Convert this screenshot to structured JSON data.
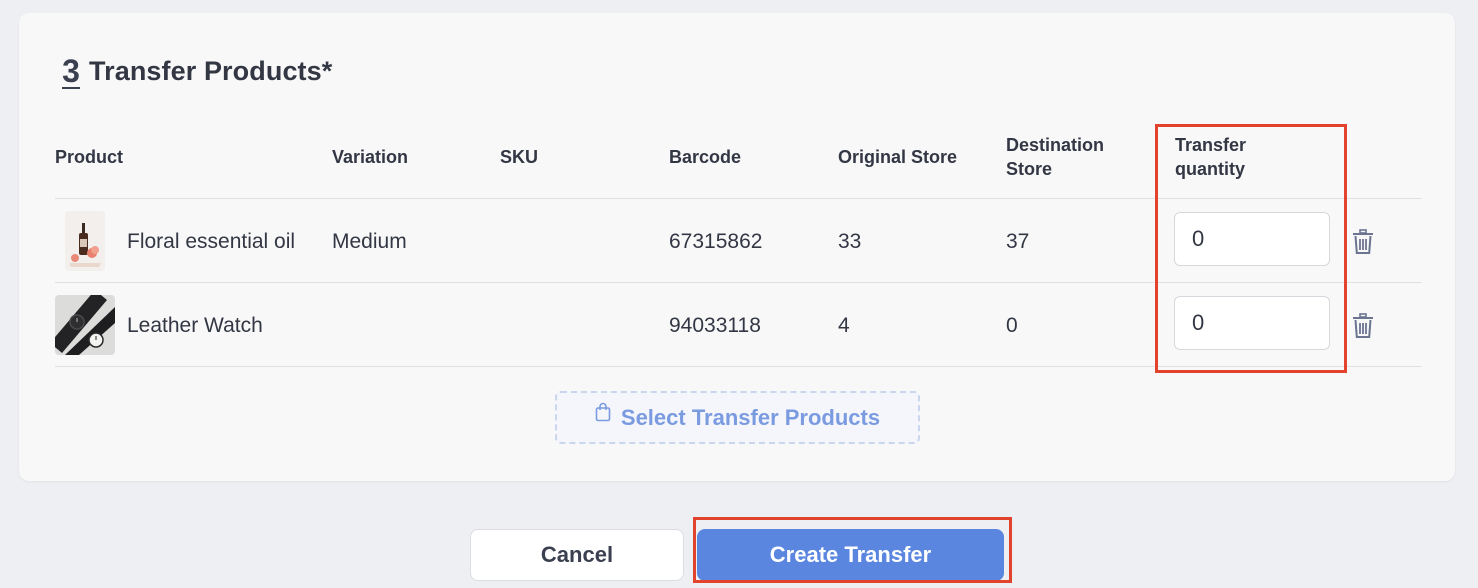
{
  "section": {
    "step_number": "3",
    "title": "Transfer Products*"
  },
  "table": {
    "headers": {
      "product": "Product",
      "variation": "Variation",
      "sku": "SKU",
      "barcode": "Barcode",
      "original_store": "Original Store",
      "destination_store": "Destination Store",
      "transfer_quantity": "Transfer quantity"
    },
    "rows": [
      {
        "product": "Floral essential oil",
        "variation": "Medium",
        "sku": "",
        "barcode": "67315862",
        "original_store": "33",
        "destination_store": "37",
        "transfer_quantity": "0",
        "thumbnail_icon": "essential-oil-product-image"
      },
      {
        "product": "Leather Watch",
        "variation": "",
        "sku": "",
        "barcode": "94033118",
        "original_store": "4",
        "destination_store": "0",
        "transfer_quantity": "0",
        "thumbnail_icon": "leather-watch-product-image"
      }
    ]
  },
  "select_products_button": {
    "label": "Select Transfer Products",
    "icon": "shopping-bag-icon"
  },
  "footer": {
    "cancel_label": "Cancel",
    "create_label": "Create Transfer"
  },
  "colors": {
    "primary": "#5a86e0",
    "highlight": "#e2432d",
    "select_button_text": "#7a9be0"
  }
}
